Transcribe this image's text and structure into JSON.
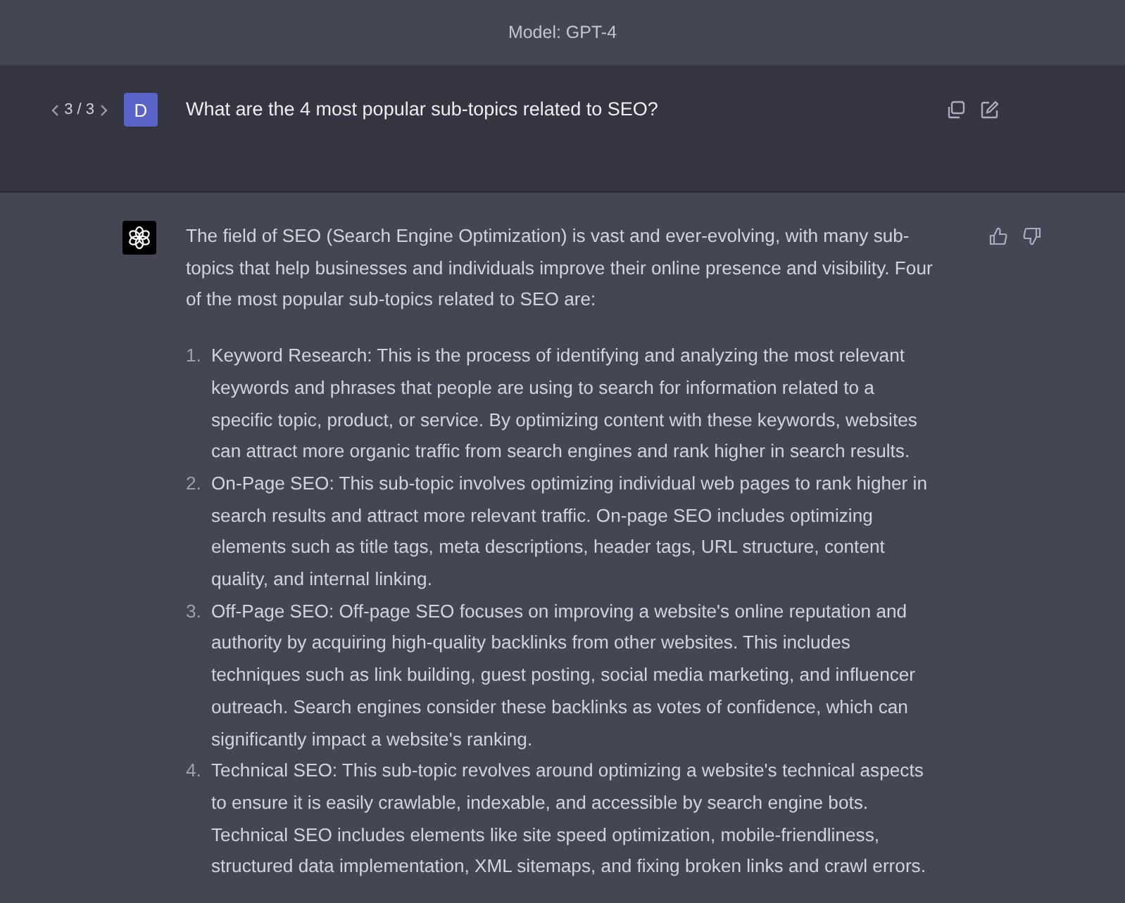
{
  "header": {
    "title": "Model: GPT-4"
  },
  "user_message": {
    "pager": "3 / 3",
    "avatar": "D",
    "text": "What are the 4 most popular sub-topics related to SEO?"
  },
  "assistant_message": {
    "intro": "The field of SEO (Search Engine Optimization) is vast and ever-evolving, with many sub-topics that help businesses and individuals improve their online presence and visibility. Four of the most popular sub-topics related to SEO are:",
    "items": [
      {
        "number": "1.",
        "text": "Keyword Research: This is the process of identifying and analyzing the most relevant keywords and phrases that people are using to search for information related to a specific topic, product, or service. By optimizing content with these keywords, websites can attract more organic traffic from search engines and rank higher in search results."
      },
      {
        "number": "2.",
        "text": "On-Page SEO: This sub-topic involves optimizing individual web pages to rank higher in search results and attract more relevant traffic. On-page SEO includes optimizing elements such as title tags, meta descriptions, header tags, URL structure, content quality, and internal linking."
      },
      {
        "number": "3.",
        "text": "Off-Page SEO: Off-page SEO focuses on improving a website's online reputation and authority by acquiring high-quality backlinks from other websites. This includes techniques such as link building, guest posting, social media marketing, and influencer outreach. Search engines consider these backlinks as votes of confidence, which can significantly impact a website's ranking."
      },
      {
        "number": "4.",
        "text": "Technical SEO: This sub-topic revolves around optimizing a website's technical aspects to ensure it is easily crawlable, indexable, and accessible by search engine bots. Technical SEO includes elements like site speed optimization, mobile-friendliness, structured data implementation, XML sitemaps, and fixing broken links and crawl errors."
      }
    ]
  }
}
